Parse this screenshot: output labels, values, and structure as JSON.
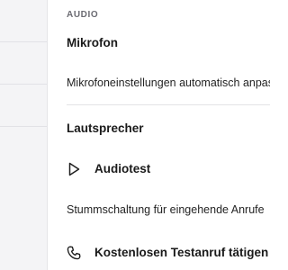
{
  "audio": {
    "section_label": "AUDIO",
    "microphone_heading": "Mikrofon",
    "microphone_auto_settings": "Mikrofoneinstellungen automatisch anpassen",
    "speaker_heading": "Lautsprecher",
    "audio_test_label": "Audiotest",
    "mute_incoming_label": "Stummschaltung für eingehende Anrufe",
    "free_test_call_label": "Kostenlosen Testanruf tätigen"
  },
  "icons": {
    "play": "play-icon",
    "phone": "phone-icon"
  },
  "colors": {
    "sidebar_bg": "#f4f4f6",
    "text": "#1a1a1a",
    "section_label": "#6b6b72"
  }
}
